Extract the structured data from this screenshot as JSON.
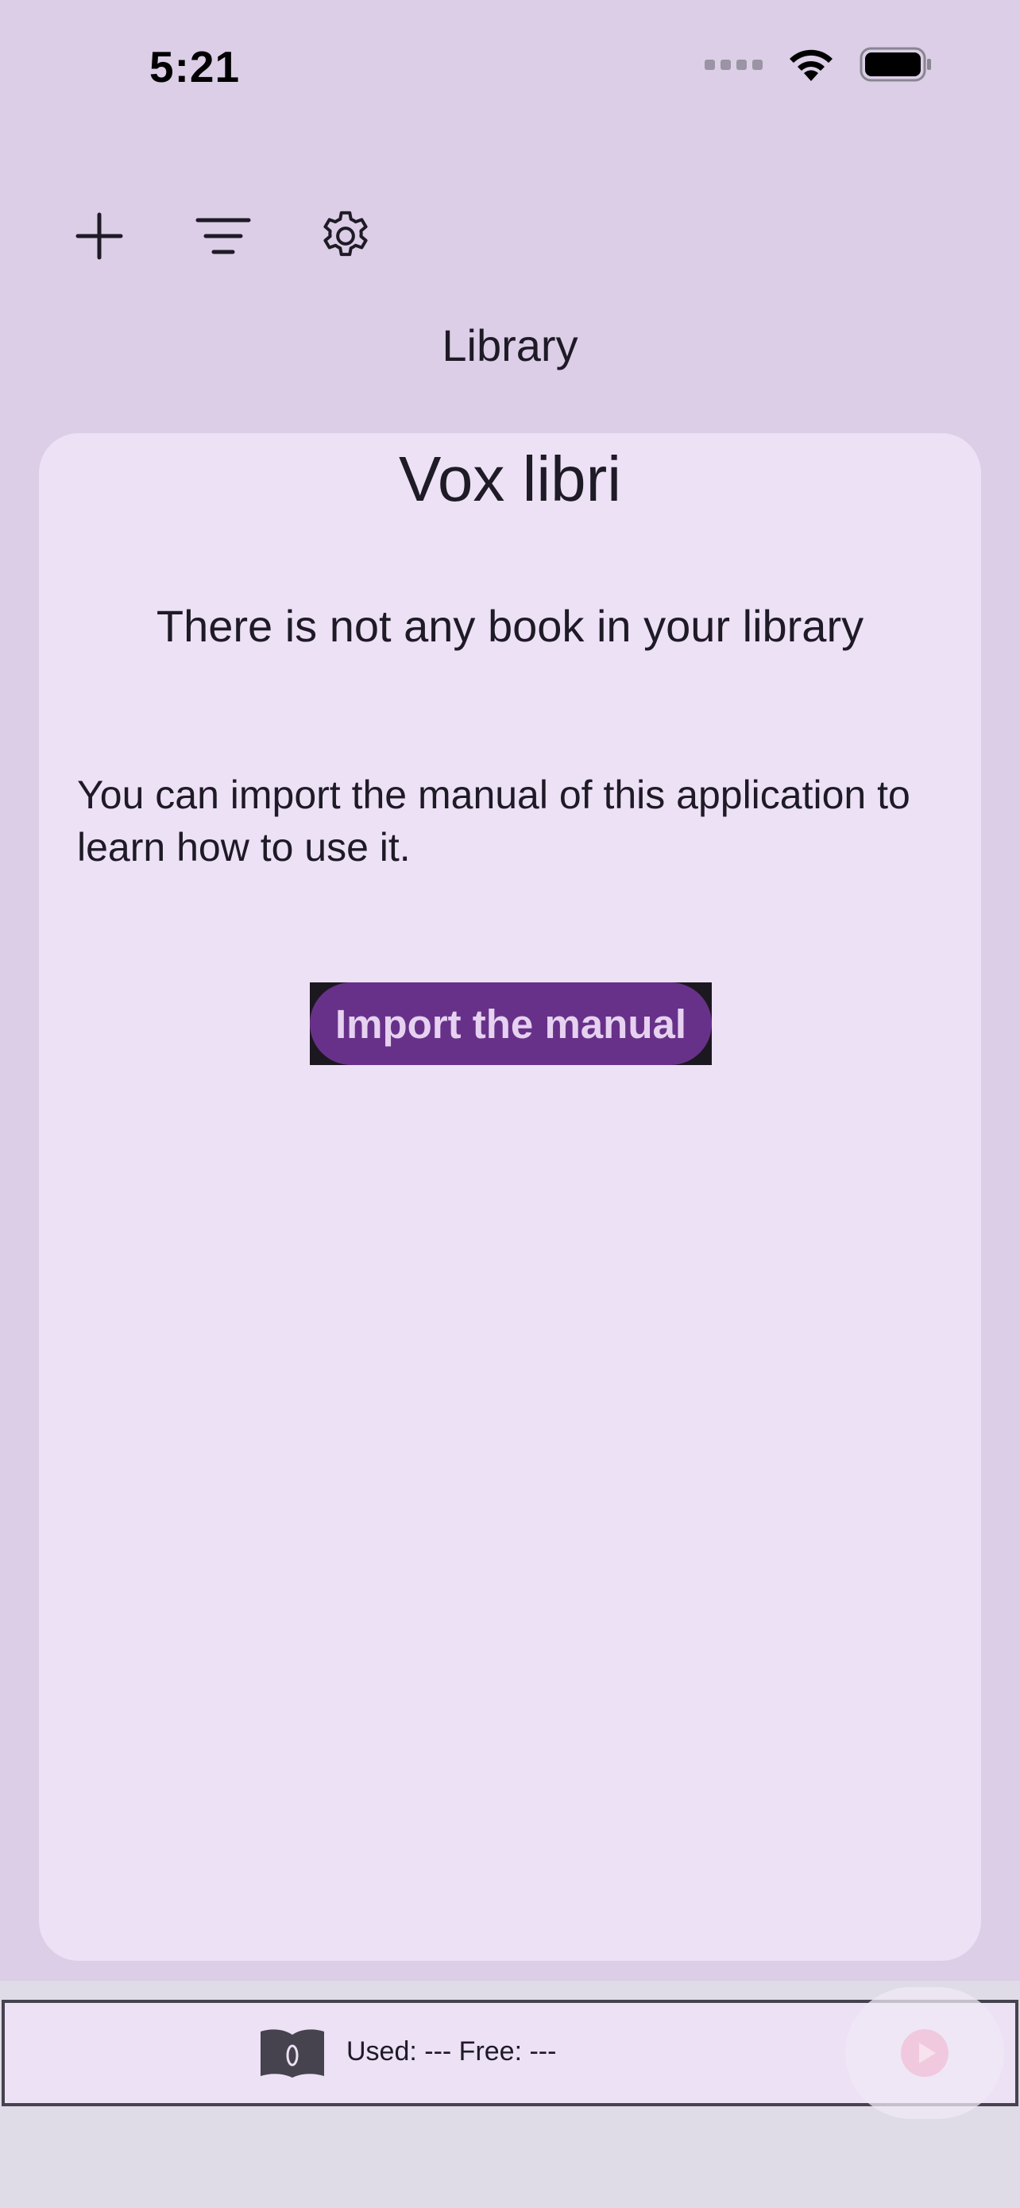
{
  "status_bar": {
    "time": "5:21",
    "icons": [
      "cellular-signal-icon",
      "wifi-icon",
      "battery-icon"
    ]
  },
  "toolbar": {
    "buttons": [
      {
        "name": "add-button",
        "icon": "plus-icon"
      },
      {
        "name": "sort-button",
        "icon": "sort-lines-icon"
      },
      {
        "name": "settings-button",
        "icon": "gear-icon"
      }
    ]
  },
  "page": {
    "title": "Library"
  },
  "card": {
    "app_name": "Vox libri",
    "empty_message": "There is not any book in your library",
    "hint": "You can import the manual of this application to learn how to use it.",
    "import_button_label": "Import the manual"
  },
  "player": {
    "book_icon": "open-book-icon",
    "storage_text": "Used: --- Free: ---",
    "play_icon": "play-icon"
  },
  "colors": {
    "background": "#dbcee6",
    "card": "#ece1f5",
    "accent": "#673189",
    "accent_text": "#e6d2f0",
    "text": "#1e1a26"
  }
}
